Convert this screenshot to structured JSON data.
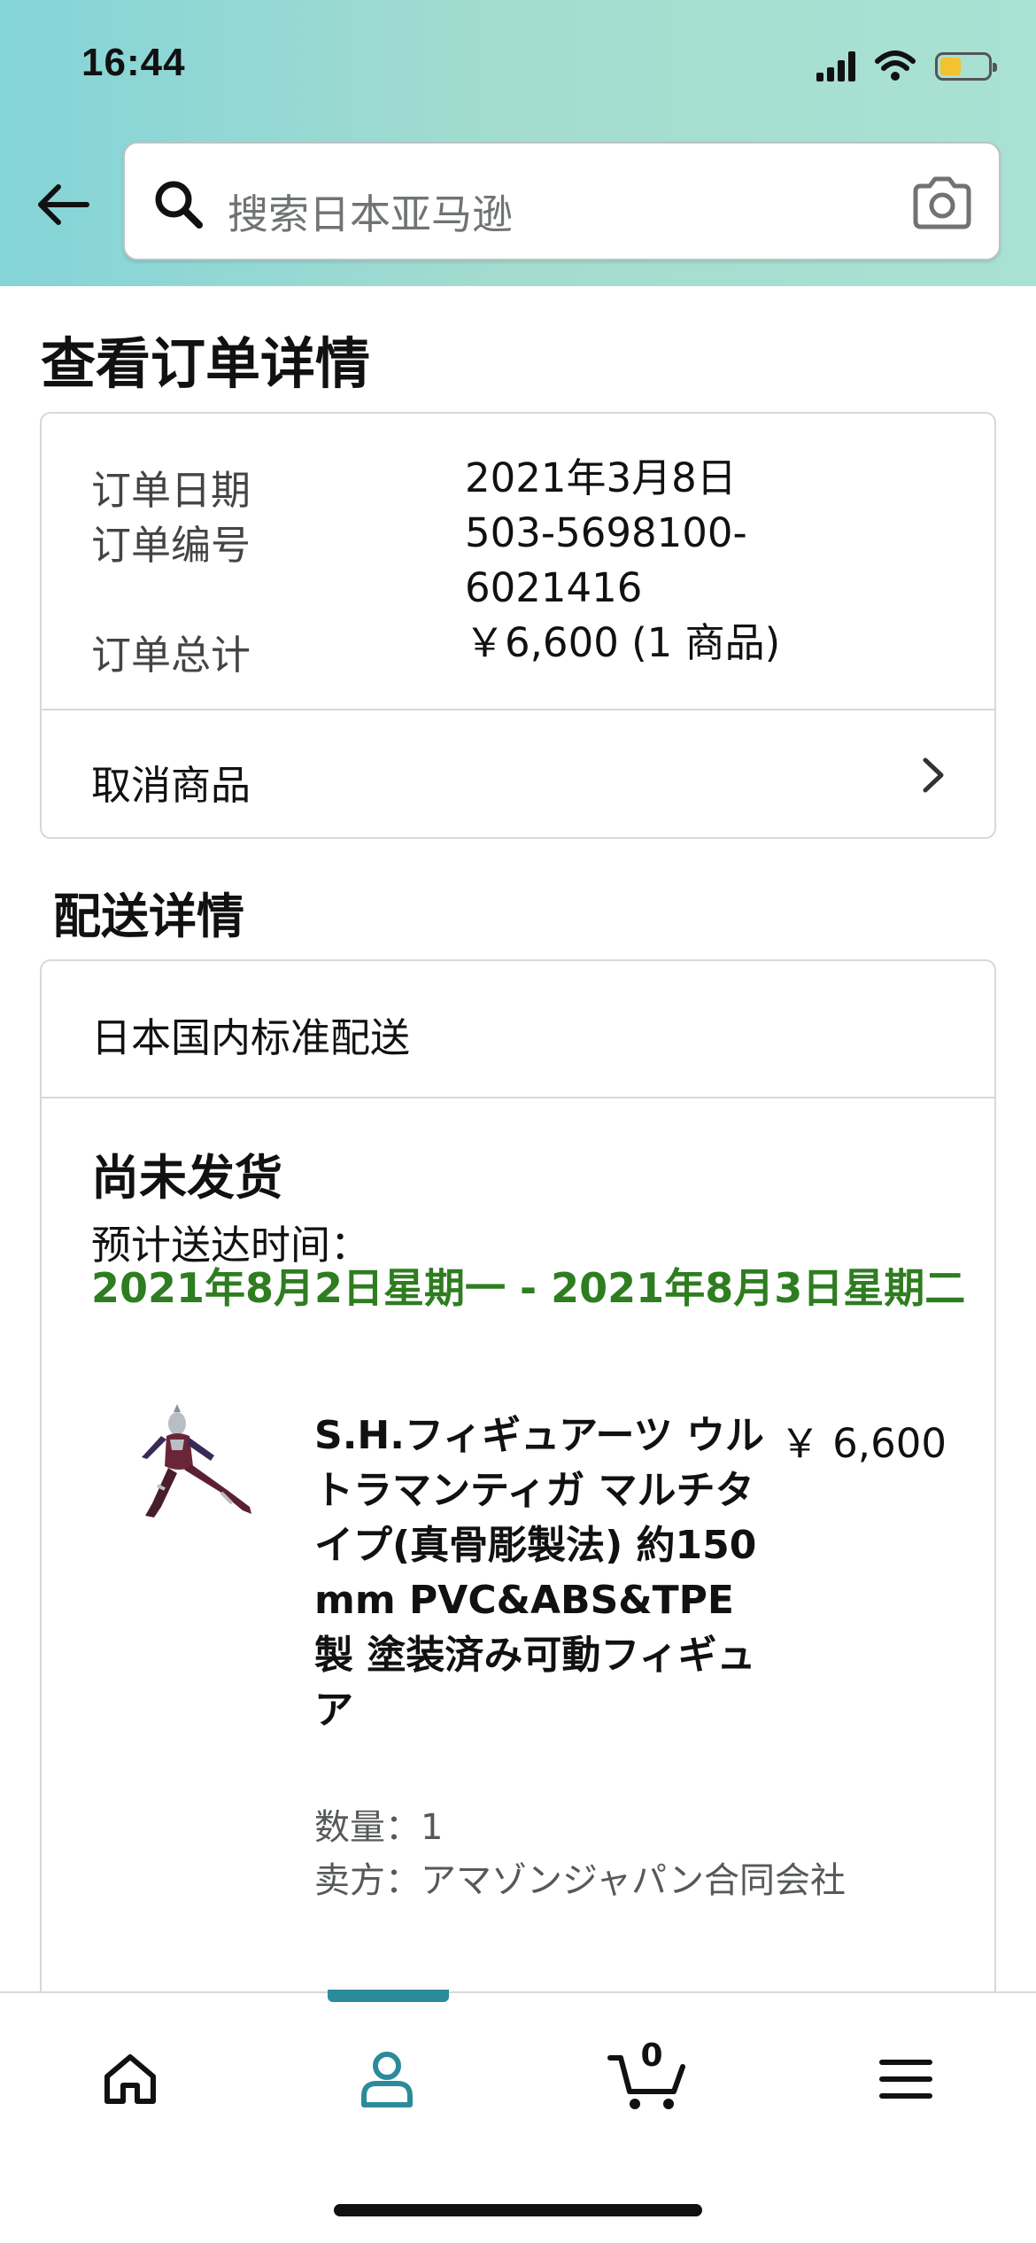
{
  "status_bar": {
    "time": "16:44"
  },
  "header": {
    "search_placeholder": "搜索日本亚马逊"
  },
  "page": {
    "title": "查看订单详情"
  },
  "order": {
    "date_label": "订单日期",
    "date_value": "2021年3月8日",
    "number_label": "订单编号",
    "number_value_line1": "503-5698100-",
    "number_value_line2": "6021416",
    "total_label": "订单总计",
    "total_value": "￥6,600 (1 商品)",
    "cancel_label": "取消商品"
  },
  "shipping": {
    "section_title": "配送详情",
    "method": "日本国内标准配送",
    "status": "尚未发货",
    "eta_label": "预计送达时间：",
    "eta_value": "2021年8月2日星期一 - 2021年8月3日星期二"
  },
  "product": {
    "title": "S.H.フィギュアーツ ウルトラマンティガ マルチタイプ(真骨彫製法) 約150mm PVC&ABS&TPE製 塗装済み可動フィギュア",
    "price": "￥ 6,600",
    "quantity": "数量：1",
    "seller": "卖方：アマゾンジャパン合同会社"
  },
  "bottom_nav": {
    "cart_count": "0",
    "active_item": "account"
  },
  "colors": {
    "header_gradient_start": "#84d4d8",
    "header_gradient_end": "#a9e1d3",
    "eta_green": "#2e7d20",
    "active_tab_accent": "#2b8b9a"
  }
}
